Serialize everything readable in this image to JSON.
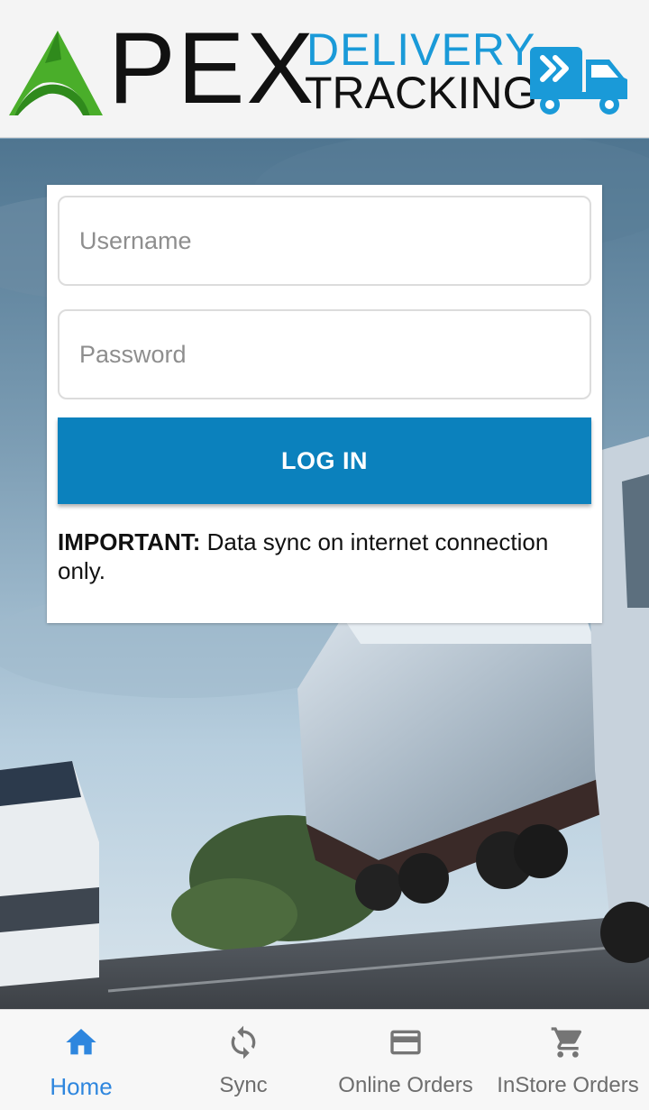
{
  "header": {
    "logo_apex": "PEX",
    "logo_line1": "DELIVERY",
    "logo_line2": "TRACKING"
  },
  "login": {
    "username_placeholder": "Username",
    "password_placeholder": "Password",
    "login_label": "LOG IN",
    "notice_bold": "IMPORTANT:",
    "notice_text": " Data sync on internet connection only."
  },
  "bottom_nav": {
    "items": [
      {
        "label": "Home",
        "icon": "home-icon",
        "active": true
      },
      {
        "label": "Sync",
        "icon": "sync-icon",
        "active": false
      },
      {
        "label": "Online Orders",
        "icon": "credit-card-icon",
        "active": false
      },
      {
        "label": "InStore Orders",
        "icon": "cart-icon",
        "active": false
      }
    ]
  },
  "colors": {
    "primary_button": "#0b81bd",
    "active_nav": "#2e86de",
    "logo_blue": "#1a9ad8",
    "logo_green": "#4aae2a"
  }
}
